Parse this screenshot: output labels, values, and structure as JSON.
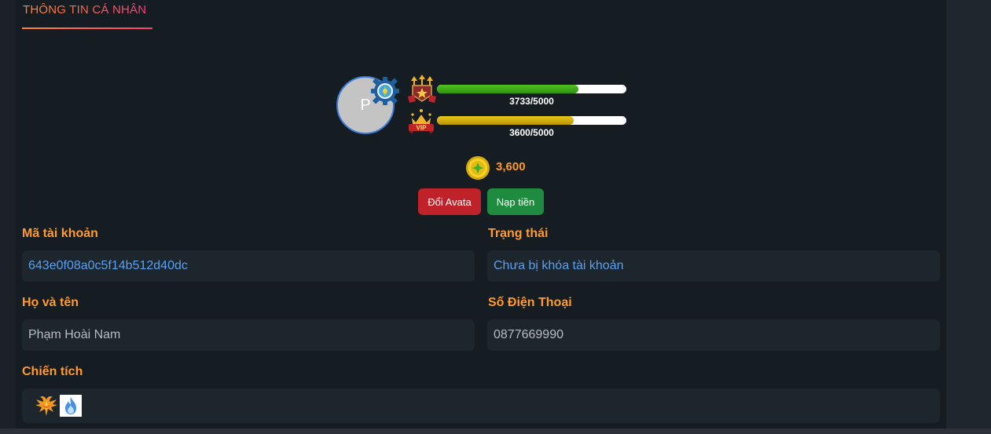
{
  "section": {
    "title": "THÔNG TIN CÁ NHÂN"
  },
  "profile": {
    "avatar_letter": "P",
    "rank_progress_text": "3733/5000",
    "rank_progress": 0.7466,
    "vip_progress_text": "3600/5000",
    "vip_progress": 0.72,
    "coins": "3,600"
  },
  "actions": {
    "change_avatar": "Đổi Avata",
    "top_up": "Nạp tiền"
  },
  "fields": {
    "account_id": {
      "label": "Mã tài khoản",
      "value": "643e0f08a0c5f14b512d40dc"
    },
    "status": {
      "label": "Trạng thái",
      "value": "Chưa bị khóa tài khoản"
    },
    "full_name": {
      "label": "Họ và tên",
      "value": "Phạm Hoài Nam"
    },
    "phone": {
      "label": "Số Điện Thoại",
      "value": "0877669990"
    },
    "achievements": {
      "label": "Chiến tích",
      "badges": [
        "phoenix-icon",
        "blue-flame-icon"
      ]
    }
  },
  "colors": {
    "accent_orange": "#ff9a2b",
    "accent_pink": "#ff3d7a",
    "link_blue": "#5aa0ee",
    "button_red": "#c0222a",
    "button_green": "#1f8b3e",
    "bar_green": "#3fad18",
    "bar_gold": "#d4b210"
  }
}
